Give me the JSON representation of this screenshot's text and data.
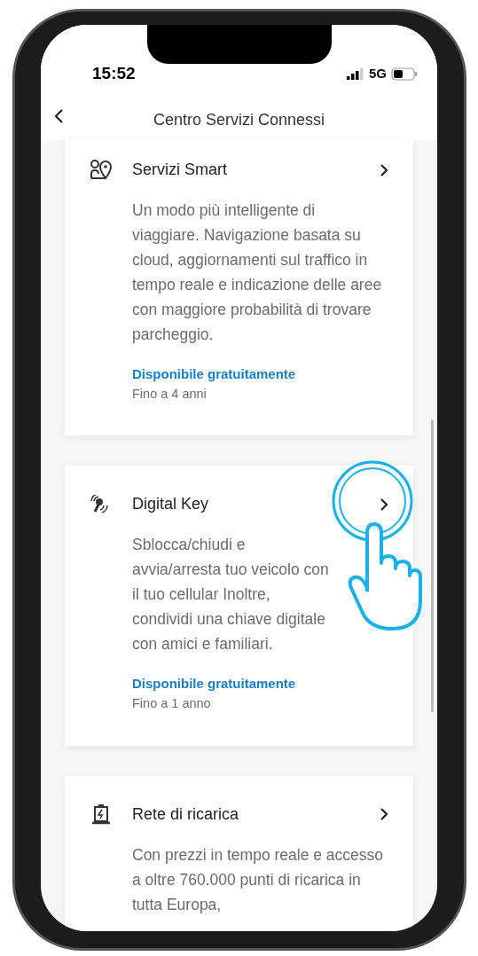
{
  "status_bar": {
    "time": "15:52",
    "network": "5G"
  },
  "nav": {
    "title": "Centro Servizi Connessi"
  },
  "services": [
    {
      "kind": "map",
      "title": "Servizi Smart",
      "description": "Un modo più intelligente di viaggiare. Navigazione basata su cloud, aggiornamenti sul traffico in tempo reale e indicazione delle aree con maggiore probabilità di trovare parcheggio.",
      "availability": "Disponibile gratuitamente",
      "duration": "Fino a 4 anni",
      "tapped": false
    },
    {
      "kind": "key",
      "title": "Digital Key",
      "description": "Sblocca/chiudi e avvia/arresta tuo veicolo con il tuo cellular Inoltre, condividi una chiave digitale con amici e familiari.",
      "availability": "Disponibile gratuitamente",
      "duration": "Fino a 1 anno",
      "tapped": true
    },
    {
      "kind": "charging",
      "title": "Rete di ricarica",
      "description": "Con prezzi in tempo reale e accesso a oltre 760.000 punti di ricarica in tutta Europa,",
      "tapped": false
    }
  ]
}
